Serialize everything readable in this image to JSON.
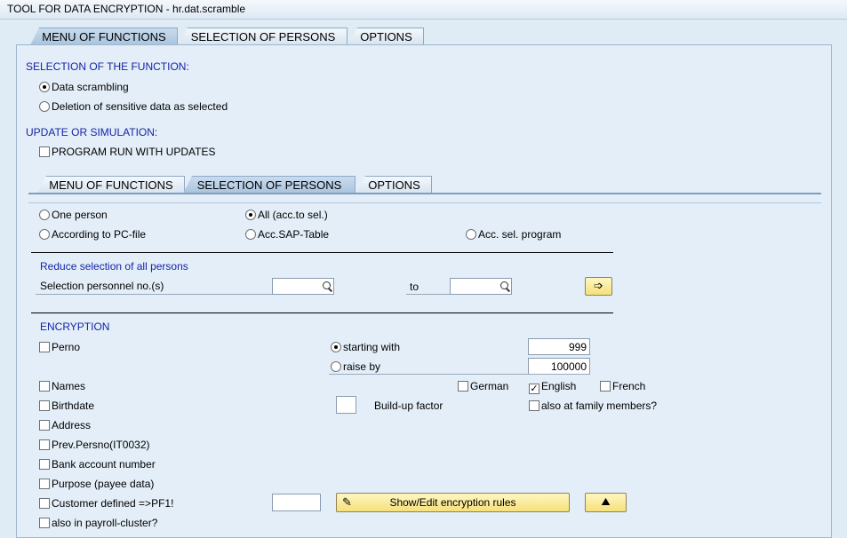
{
  "window": {
    "title": "TOOL FOR DATA ENCRYPTION - hr.dat.scramble"
  },
  "tabs_top": [
    "MENU OF FUNCTIONS",
    "SELECTION OF PERSONS",
    "OPTIONS"
  ],
  "function_section": {
    "heading": "SELECTION OF THE FUNCTION:",
    "options": [
      "Data scrambling",
      "Deletion of sensitive data as selected"
    ],
    "selected": 0
  },
  "update_section": {
    "heading": "UPDATE OR SIMULATION:",
    "checkbox": "PROGRAM RUN WITH UPDATES"
  },
  "tabs_inner": [
    "MENU OF FUNCTIONS",
    "SELECTION OF PERSONS",
    "OPTIONS"
  ],
  "person_selection": {
    "one_person": "One person",
    "all": "All (acc.to sel.)",
    "pc_file": "According to PC-file",
    "sap_table": "Acc.SAP-Table",
    "sel_program": "Acc. sel. program"
  },
  "reduce": {
    "heading": "Reduce selection of all persons",
    "label": "Selection personnel no.(s)",
    "to": "to"
  },
  "encryption": {
    "heading": "ENCRYPTION",
    "perno": "Perno",
    "starting_with": "starting with",
    "starting_value": "999",
    "raise_by": "raise by",
    "raise_value": "100000",
    "names": "Names",
    "german": "German",
    "english": "English",
    "french": "French",
    "birthdate": "Birthdate",
    "buildup": "Build-up factor",
    "family": "also at family members?",
    "address": "Address",
    "prev_perno": "Prev.Persno(IT0032)",
    "bank": "Bank account number",
    "purpose": "Purpose (payee data)",
    "customer": "Customer defined =>PF1!",
    "show_edit": "Show/Edit encryption rules",
    "payroll": "also in payroll-cluster?"
  },
  "checkmark": "✓"
}
